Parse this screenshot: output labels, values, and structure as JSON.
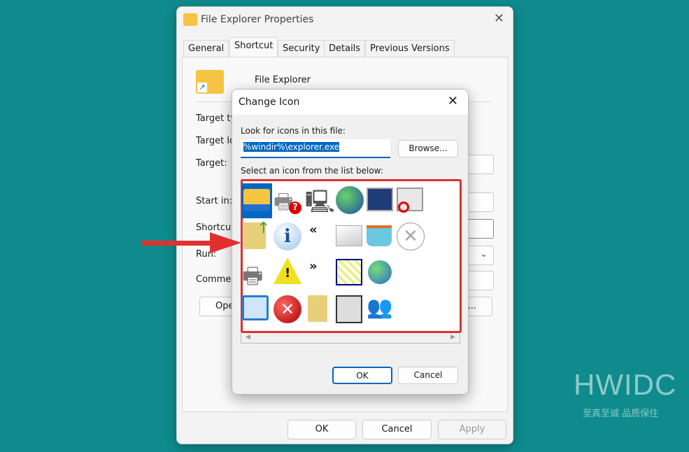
{
  "properties_window": {
    "title": "File Explorer Properties",
    "tabs": [
      "General",
      "Shortcut",
      "Security",
      "Details",
      "Previous Versions"
    ],
    "active_tab": "Shortcut",
    "name": "File Explorer",
    "labels": {
      "target_type": "Target ty",
      "target_location": "Target lo",
      "target": "Target:",
      "start_in": "Start in:",
      "shortcut_key": "Shortcut",
      "run": "Run:",
      "comment": "Commer"
    },
    "open_button": "Ope",
    "advanced_button": "l...",
    "ok": "OK",
    "cancel": "Cancel",
    "apply": "Apply"
  },
  "change_icon": {
    "title": "Change Icon",
    "look_label": "Look for icons in this file:",
    "file_value": "%windir%\\explorer.exe",
    "browse": "Browse...",
    "select_label": "Select an icon from the list below:",
    "icons": [
      [
        "folder",
        "printer-question",
        "computer",
        "globe",
        "windows-cascade",
        "window-blocked"
      ],
      [
        "folder-up-arrow",
        "info",
        "rewind",
        "envelope",
        "shopping-basket",
        "circle-x"
      ],
      [
        "printer",
        "warning",
        "fast-forward",
        "window-grid",
        "globe-orbit"
      ],
      [
        "window-pen",
        "error",
        "folder-narrow",
        "server-list",
        "users"
      ]
    ],
    "ok": "OK",
    "cancel": "Cancel"
  },
  "watermark": {
    "brand": "HWIDC",
    "tagline": "至真至诚 品质保住"
  },
  "colors": {
    "background": "#0f8b8d",
    "highlight": "#e03030",
    "accent": "#0067c0"
  }
}
